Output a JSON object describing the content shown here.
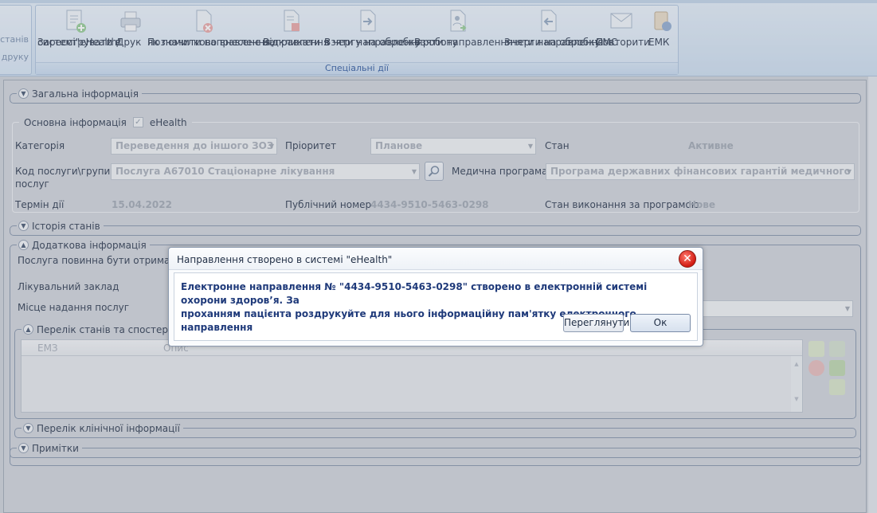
{
  "ribbon": {
    "left_group_labels": [
      "станів",
      "друку"
    ],
    "group_caption": "Спеціальні дії",
    "buttons": [
      {
        "l1": "Зареєструвати в",
        "l2": "системі\"eHealth\"",
        "icon": "register-ehealth-icon"
      },
      {
        "l1": "Друк",
        "l2": "",
        "icon": "printer-icon"
      },
      {
        "l1": "Позначити направлення,",
        "l2": "як помилково внесене",
        "icon": "mark-error-icon"
      },
      {
        "l1": "Відкликати",
        "l2": "направлення",
        "icon": "revoke-icon"
      },
      {
        "l1": "Взяти направлення",
        "l2": "в чергу на обробку",
        "icon": "queue-icon"
      },
      {
        "l1": "Взяти направлення",
        "l2": "в роботу",
        "icon": "take-to-work-icon"
      },
      {
        "l1": "Зняти направлення",
        "l2": "з черги на обробку",
        "icon": "remove-queue-icon"
      },
      {
        "l1": "Повторити",
        "l2": "СМС",
        "icon": "sms-icon"
      },
      {
        "l1": "ЕМК",
        "l2": "",
        "icon": "emk-icon"
      }
    ]
  },
  "general": {
    "title": "Загальна інформація"
  },
  "main_info": {
    "title": "Основна інформація",
    "ehealth_label": "eHealth",
    "category_label": "Категорія",
    "category_value": "Переведення до іншого ЗОЗ",
    "priority_label": "Пріоритет",
    "priority_value": "Планове",
    "state_label": "Стан",
    "state_value": "Активне",
    "service_label_1": "Код послуги\\групи",
    "service_label_2": "послуг",
    "service_value": "Послуга А67010 Стаціонарне лікування",
    "program_label": "Медична програма",
    "program_value": "Програма державних фінансових гарантій медичного обслуго",
    "term_label": "Термін дії",
    "term_value": "15.04.2022",
    "public_number_label": "Публічний номер",
    "public_number_value": "4434-9510-5463-0298",
    "program_state_label": "Стан виконання за програмою",
    "program_state_value": "Нове"
  },
  "history": {
    "title": "Історія станів"
  },
  "additional": {
    "title": "Додаткова інформація",
    "service_must_label": "Послуга повинна бути отримана з",
    "facility_label": "Лікувальний заклад",
    "place_label": "Місце надання послуг",
    "states_title": "Перелік станів та спостережень",
    "col_emz": "ЕМЗ",
    "col_desc": "Опис"
  },
  "clinical": {
    "title": "Перелік клінічної інформації"
  },
  "notes": {
    "title": "Примітки"
  },
  "dialog": {
    "title": "Направлення створено в системі \"eHealth\"",
    "message_1": "Електронне направлення № \"4434-9510-5463-0298\" створено в електронній системі охорони здоров’я. За",
    "message_2": "проханням пацієнта роздрукуйте для нього інформаційну пам'ятку електронного направлення",
    "view_button": "Переглянути",
    "ok_button": "Ок",
    "close_glyph": "✕"
  },
  "colors": {
    "dialog_message": "#1f3a7a",
    "close_button": "#d11a12",
    "ribbon_caption": "#25509a"
  }
}
